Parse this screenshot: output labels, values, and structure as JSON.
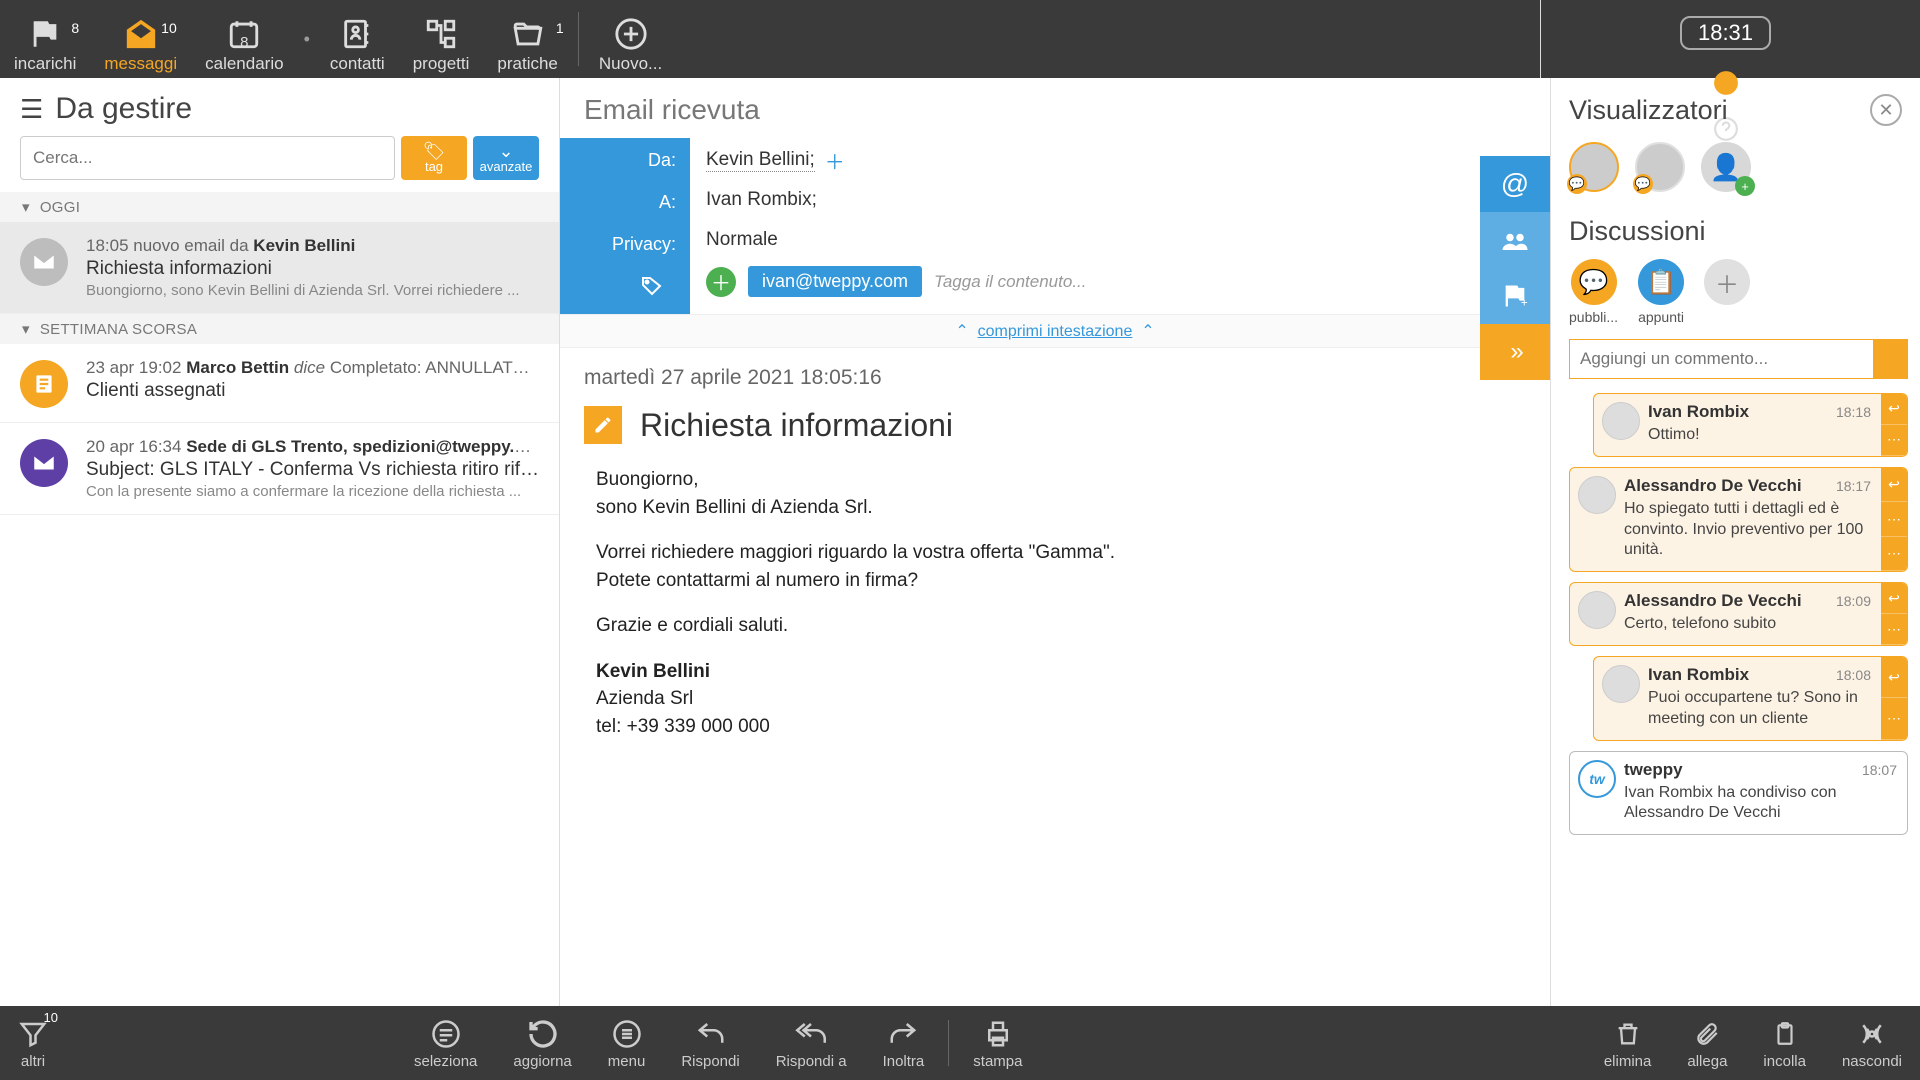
{
  "topnav": {
    "items": [
      {
        "id": "incarichi",
        "label": "incarichi",
        "badge": "8"
      },
      {
        "id": "messaggi",
        "label": "messaggi",
        "badge": "10"
      },
      {
        "id": "calendario",
        "label": "calendario",
        "badge": "8"
      },
      {
        "id": "contatti",
        "label": "contatti"
      },
      {
        "id": "progetti",
        "label": "progetti"
      },
      {
        "id": "pratiche",
        "label": "pratiche",
        "badge": "1"
      },
      {
        "id": "nuovo",
        "label": "Nuovo..."
      }
    ],
    "clock": "18:31"
  },
  "left": {
    "title": "Da gestire",
    "search_placeholder": "Cerca...",
    "tag_label": "tag",
    "adv_label": "avanzate",
    "sections": {
      "today": "OGGI",
      "lastweek": "SETTIMANA SCORSA"
    },
    "items": [
      {
        "section": "today",
        "icon": "gray",
        "line1_pre": "18:05 nuovo email da  ",
        "line1_bold": "Kevin Bellini",
        "title": "Richiesta informazioni",
        "preview": "Buongiorno, sono Kevin Bellini di Azienda Srl. Vorrei richiedere ...",
        "selected": true
      },
      {
        "section": "lastweek",
        "icon": "orange",
        "line1_pre": "23 apr 19:02  ",
        "line1_bold": "Marco Bettin",
        "line1_italic": "  dice ",
        "line1_post": "Completato: ANNULLATO ...",
        "title": "Clienti assegnati",
        "preview": ""
      },
      {
        "section": "lastweek",
        "icon": "purple",
        "line1_pre": "20 apr 16:34  ",
        "line1_bold": "Sede di GLS Trento, spedizioni@tweppy.com",
        "title": "Subject: GLS ITALY - Conferma Vs richiesta ritiro riferi...",
        "preview": "Con la presente siamo a confermare la ricezione della richiesta ..."
      }
    ]
  },
  "email": {
    "header_kind": "Email ricevuta",
    "labels": {
      "from": "Da:",
      "to": "A:",
      "privacy": "Privacy:"
    },
    "from": "Kevin Bellini;",
    "to": "Ivan Rombix;",
    "privacy": "Normale",
    "tag": "ivan@tweppy.com",
    "tag_hint": "Tagga il contenuto...",
    "collapse": "comprimi intestazione",
    "date": "martedì 27 aprile 2021 18:05:16",
    "subject": "Richiesta informazioni",
    "body": {
      "p1": "Buongiorno,",
      "p1b": "sono Kevin Bellini di Azienda Srl.",
      "p2": "Vorrei richiedere maggiori riguardo la vostra offerta \"Gamma\".",
      "p2b": "Potete contattarmi al numero in firma?",
      "p3": "Grazie e cordiali saluti.",
      "sig_name": "Kevin Bellini",
      "sig_company": "Azienda Srl",
      "sig_tel": "tel: +39 339 000 000"
    }
  },
  "right": {
    "viewers_title": "Visualizzatori",
    "discussions_title": "Discussioni",
    "tabs": {
      "public": "pubbli...",
      "notes": "appunti"
    },
    "comment_placeholder": "Aggiungi un commento...",
    "comments": [
      {
        "author": "Ivan Rombix",
        "time": "18:18",
        "text": "Ottimo!",
        "indent": true
      },
      {
        "author": "Alessandro De Vecchi",
        "time": "18:17",
        "text": "Ho spiegato tutti i dettagli ed è convinto. Invio preventivo per 100 unità.",
        "indent": false
      },
      {
        "author": "Alessandro De Vecchi",
        "time": "18:09",
        "text": "Certo, telefono subito",
        "indent": false
      },
      {
        "author": "Ivan Rombix",
        "time": "18:08",
        "text": "Puoi occupartene tu? Sono in meeting con un cliente",
        "indent": true
      },
      {
        "author": "tweppy",
        "time": "18:07",
        "text": "Ivan Rombix ha condiviso con Alessandro De Vecchi",
        "indent": false,
        "system": true
      }
    ]
  },
  "bottom": {
    "items_left": [
      {
        "id": "altri",
        "label": "altri",
        "badge": "10"
      }
    ],
    "items_center": [
      {
        "id": "seleziona",
        "label": "seleziona"
      },
      {
        "id": "aggiorna",
        "label": "aggiorna"
      },
      {
        "id": "menu",
        "label": "menu"
      },
      {
        "id": "rispondi",
        "label": "Rispondi"
      },
      {
        "id": "rispondi_a",
        "label": "Rispondi a"
      },
      {
        "id": "inoltra",
        "label": "Inoltra"
      },
      {
        "id": "stampa",
        "label": "stampa"
      }
    ],
    "items_right": [
      {
        "id": "elimina",
        "label": "elimina"
      },
      {
        "id": "allega",
        "label": "allega"
      },
      {
        "id": "incolla",
        "label": "incolla"
      },
      {
        "id": "nascondi",
        "label": "nascondi"
      }
    ]
  }
}
